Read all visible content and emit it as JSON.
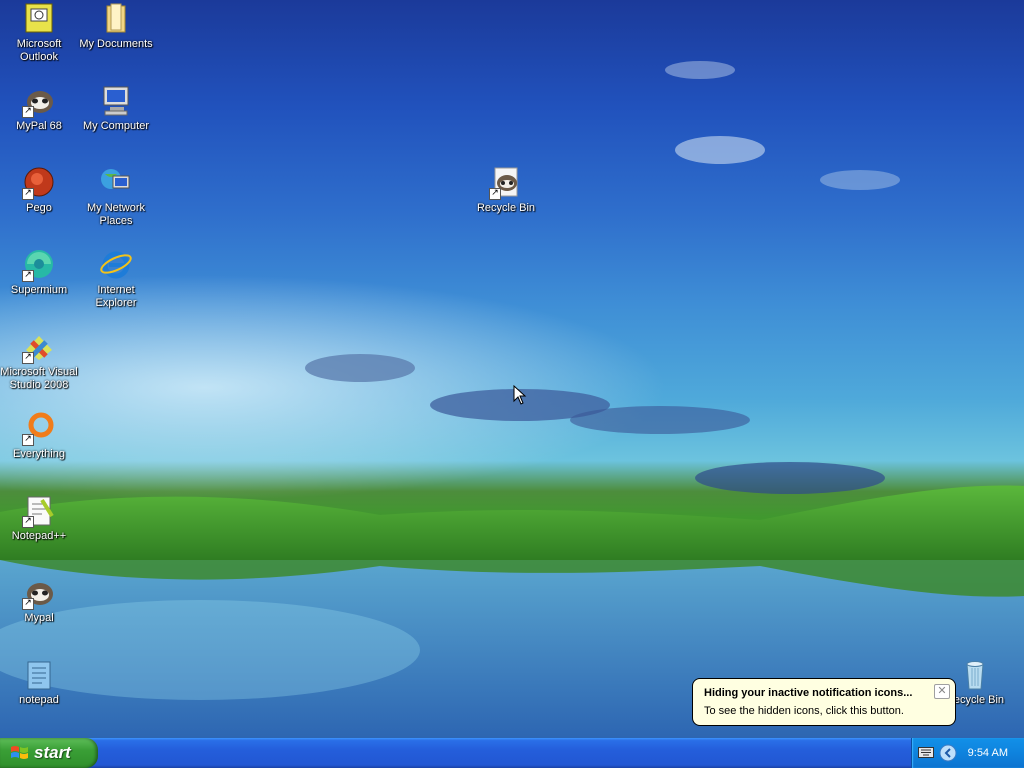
{
  "desktop": {
    "icons": [
      {
        "label": "Microsoft Outlook",
        "icon": "outlook-icon"
      },
      {
        "label": "My Documents",
        "icon": "folder-icon"
      },
      {
        "label": "MyPal 68",
        "icon": "mypal-icon"
      },
      {
        "label": "My Computer",
        "icon": "computer-icon"
      },
      {
        "label": "Pego",
        "icon": "pego-icon"
      },
      {
        "label": "My Network Places",
        "icon": "network-icon"
      },
      {
        "label": "Supermium",
        "icon": "supermium-icon"
      },
      {
        "label": "Internet Explorer",
        "icon": "ie-icon"
      },
      {
        "label": "Microsoft Visual Studio 2008",
        "icon": "visual-studio-icon"
      },
      {
        "label": "Everything",
        "icon": "everything-icon"
      },
      {
        "label": "Notepad++",
        "icon": "notepadpp-icon"
      },
      {
        "label": "Mypal",
        "icon": "mypal-icon"
      },
      {
        "label": "notepad",
        "icon": "notepad-icon"
      },
      {
        "label": "Recycle Bin",
        "icon": "mypal-shortcut-icon"
      },
      {
        "label": "Recycle Bin",
        "icon": "recycle-bin-icon"
      }
    ]
  },
  "taskbar": {
    "start_label": "start",
    "clock": "9:54 AM"
  },
  "balloon": {
    "title": "Hiding your inactive notification icons...",
    "text": "To see the hidden icons, click this button."
  },
  "colors": {
    "taskbar": "#245edb",
    "start_button": "#3a9f36",
    "tray": "#0f86e0",
    "balloon": "#ffffe1"
  }
}
